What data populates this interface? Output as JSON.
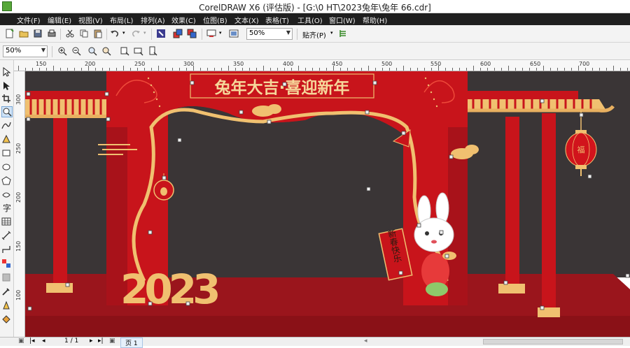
{
  "titlebar": {
    "title": "CorelDRAW X6 (评估版) - [G:\\0 HT\\2023兔年\\兔年 66.cdr]"
  },
  "menu": {
    "items": [
      "文件(F)",
      "编辑(E)",
      "视图(V)",
      "布局(L)",
      "排列(A)",
      "效果(C)",
      "位图(B)",
      "文本(X)",
      "表格(T)",
      "工具(O)",
      "窗口(W)",
      "帮助(H)"
    ]
  },
  "toolbar": {
    "zoom_value": "50%",
    "snap_label": "贴齐(P)",
    "prop_zoom_value": "50%"
  },
  "ruler": {
    "h_labels": [
      "150",
      "200",
      "250",
      "300",
      "350",
      "400",
      "450",
      "500",
      "550",
      "600",
      "650",
      "700"
    ],
    "v_labels": [
      "300",
      "250",
      "200",
      "150",
      "100"
    ]
  },
  "artwork": {
    "banner_title": "兔年大吉·喜迎新年",
    "year": "2023",
    "scroll_text": "新春快乐",
    "lantern_text": "福",
    "colors": {
      "red": "#c8141b",
      "dark_red": "#8f0f16",
      "gold": "#f0c070",
      "backdrop": "#3a3536",
      "floor": "#9a151c"
    }
  },
  "status": {
    "page_count": "1 / 1",
    "page_tab": "页 1"
  }
}
